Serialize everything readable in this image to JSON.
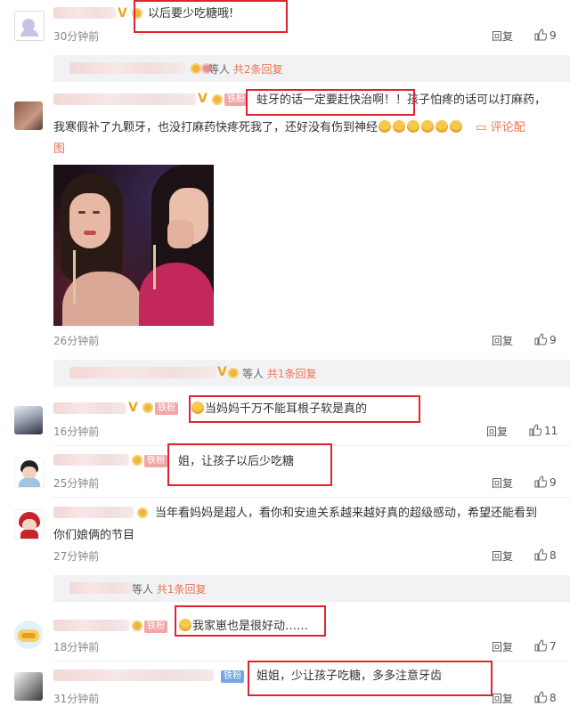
{
  "actions": {
    "reply": "回复"
  },
  "comments": [
    {
      "text": "以后要少吃糖哦!",
      "time": "30分钟前",
      "likes": "9"
    },
    {
      "text": "蛀牙的话一定要赶快治啊！！孩子怕疼的话可以打麻药，",
      "text2": "我寒假补了九颗牙，也没打麻药快疼死我了，还好没有伤到神经",
      "annotation": "评论配",
      "annotation2": "图",
      "time": "26分钟前",
      "likes": "9"
    },
    {
      "text": "当妈妈千万不能耳根子软是真的",
      "time": "16分钟前",
      "likes": "11"
    },
    {
      "text": "姐，让孩子以后少吃糖",
      "time": "25分钟前",
      "likes": "9"
    },
    {
      "text": "当年看妈妈是超人，看你和安迪关系越来越好真的超级感动，希望还能看到",
      "text2": "你们娘俩的节目",
      "time": "27分钟前",
      "likes": "8"
    },
    {
      "text": "我家崽也是很好动……",
      "time": "18分钟前",
      "likes": "7"
    },
    {
      "text": "姐姐，少让孩子吃糖，多多注意牙齿",
      "time": "31分钟前",
      "likes": "8"
    }
  ],
  "threads": [
    {
      "prefix": "等人",
      "more": "共2条回复"
    },
    {
      "prefix": "等人",
      "more": "共1条回复"
    },
    {
      "prefix": "等人",
      "more": "共1条回复"
    }
  ],
  "badges": {
    "fan": "铁粉",
    "vip": "V"
  },
  "colors": {
    "highlight_box": "#e2232f",
    "link": "#eb7350",
    "thread_bg": "#f2f2f5"
  }
}
